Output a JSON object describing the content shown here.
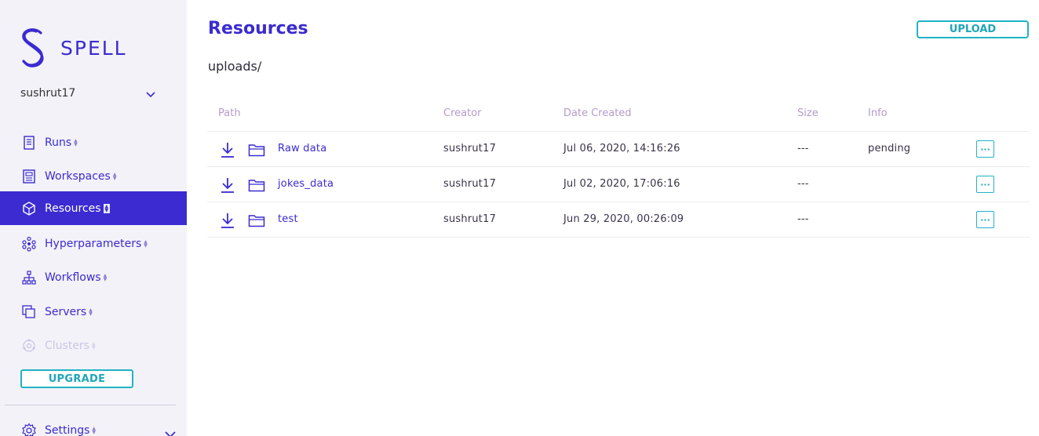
{
  "brand": {
    "name": "SPELL",
    "color": "#3b2bd0"
  },
  "user": {
    "name": "sushrut17"
  },
  "nav": [
    {
      "label": "Runs",
      "icon": "document-icon",
      "state": "normal"
    },
    {
      "label": "Workspaces",
      "icon": "notebook-icon",
      "state": "normal"
    },
    {
      "label": "Resources",
      "icon": "cube-icon",
      "state": "active"
    },
    {
      "label": "Hyperparameters",
      "icon": "dots-grid-icon",
      "state": "normal"
    },
    {
      "label": "Workflows",
      "icon": "hierarchy-icon",
      "state": "normal"
    },
    {
      "label": "Servers",
      "icon": "stacked-squares-icon",
      "state": "normal"
    },
    {
      "label": "Clusters",
      "icon": "cluster-icon",
      "state": "disabled"
    }
  ],
  "upgrade_label": "UPGRADE",
  "settings_label": "Settings",
  "page": {
    "title": "Resources",
    "breadcrumb": "uploads/",
    "upload_label": "UPLOAD"
  },
  "table": {
    "headers": {
      "path": "Path",
      "creator": "Creator",
      "date": "Date Created",
      "size": "Size",
      "info": "Info"
    },
    "rows": [
      {
        "name": "Raw data",
        "creator": "sushrut17",
        "date": "Jul 06, 2020, 14:16:26",
        "size": "---",
        "info": "pending",
        "more": "···"
      },
      {
        "name": "jokes_data",
        "creator": "sushrut17",
        "date": "Jul 02, 2020, 17:06:16",
        "size": "---",
        "info": "",
        "more": "···"
      },
      {
        "name": "test",
        "creator": "sushrut17",
        "date": "Jun 29, 2020, 00:26:09",
        "size": "---",
        "info": "",
        "more": "···"
      }
    ]
  },
  "colors": {
    "accent": "#3b2bd0",
    "teal": "#20b3c6",
    "sidebar_bg": "#f3f2f8"
  }
}
